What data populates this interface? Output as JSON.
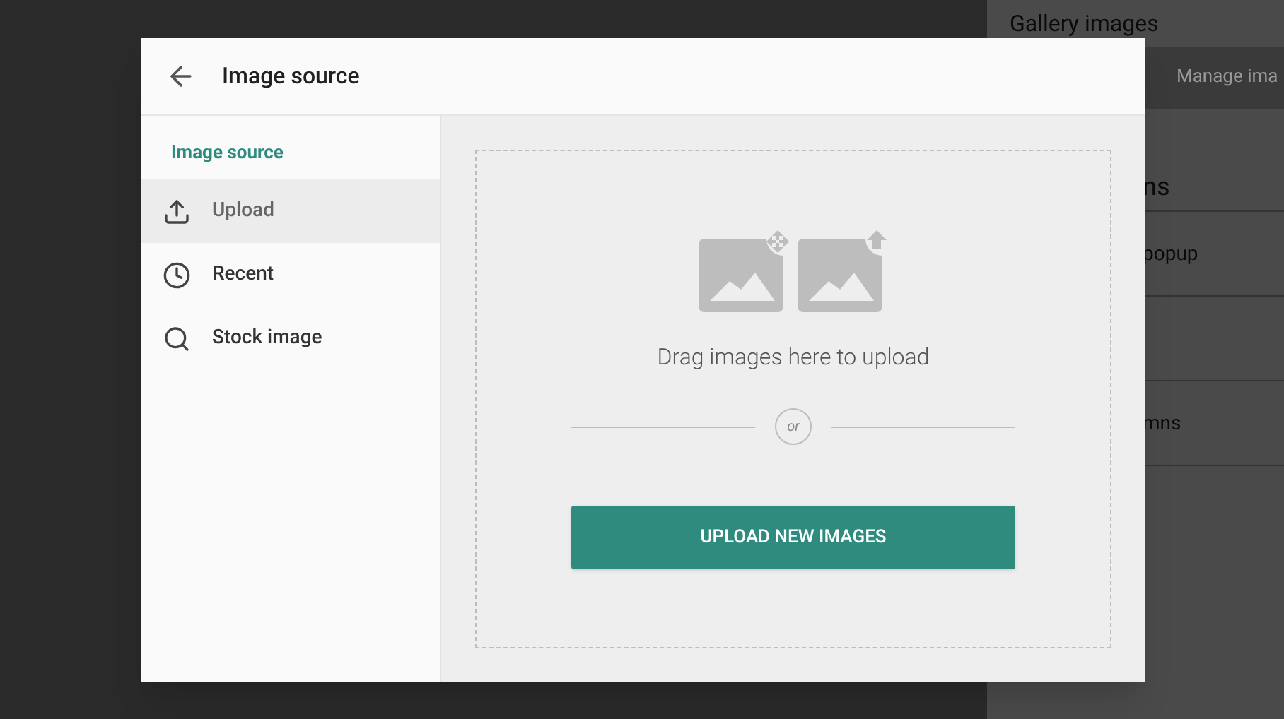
{
  "background_panel": {
    "title": "Gallery images",
    "tab": "Manage ima",
    "rows": [
      "ns",
      "popup",
      "",
      "mns"
    ]
  },
  "dialog": {
    "title": "Image source",
    "sidebar": {
      "heading": "Image source",
      "items": [
        {
          "label": "Upload",
          "kind": "upload",
          "selected": true
        },
        {
          "label": "Recent",
          "kind": "recent",
          "selected": false
        },
        {
          "label": "Stock image",
          "kind": "search",
          "selected": false
        }
      ]
    },
    "dropzone": {
      "prompt": "Drag images here to upload",
      "separator": "or",
      "button": "UPLOAD NEW IMAGES"
    }
  }
}
